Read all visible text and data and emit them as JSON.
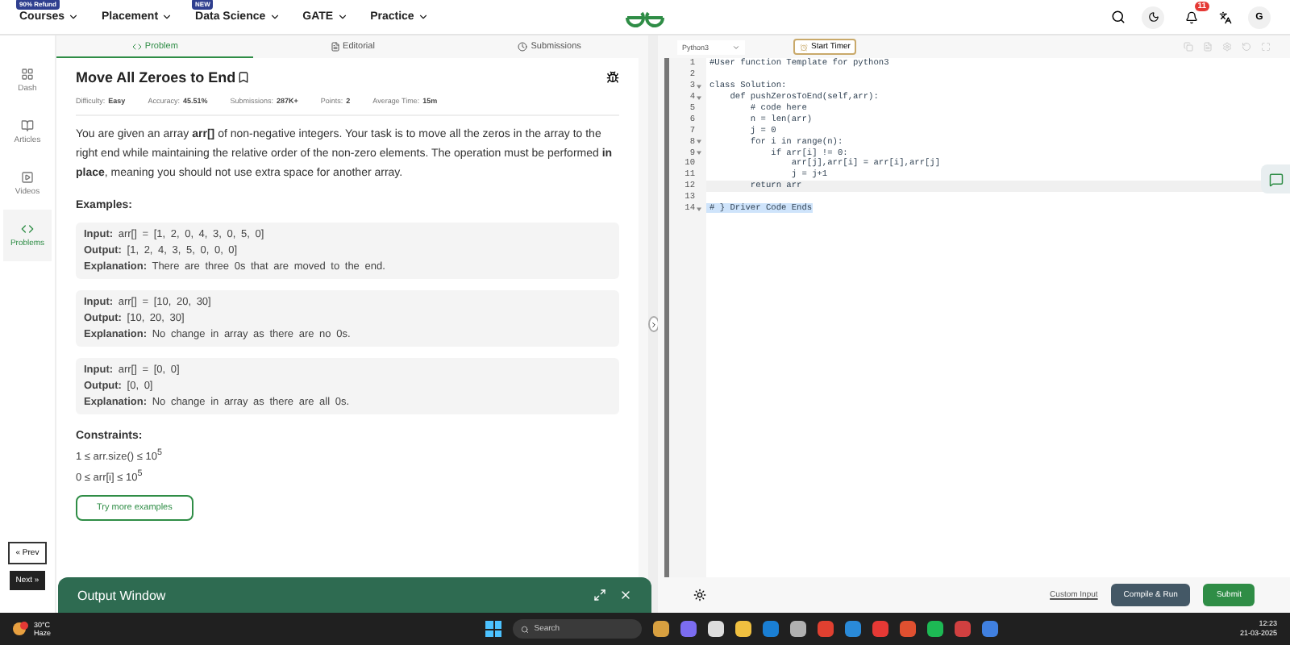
{
  "nav": {
    "items": [
      {
        "label": "Courses",
        "badge": "90% Refund"
      },
      {
        "label": "Placement"
      },
      {
        "label": "Data Science",
        "badge": "NEW"
      },
      {
        "label": "GATE"
      },
      {
        "label": "Practice"
      }
    ],
    "notification_count": "11",
    "avatar": "G"
  },
  "sidebar": {
    "items": [
      {
        "label": "Dash",
        "selected": false
      },
      {
        "label": "Articles",
        "selected": false
      },
      {
        "label": "Videos",
        "selected": false
      },
      {
        "label": "Problems",
        "selected": true
      }
    ],
    "prev": "« Prev",
    "next": "Next »"
  },
  "tabs": [
    {
      "label": "Problem",
      "selected": true
    },
    {
      "label": "Editorial",
      "selected": false
    },
    {
      "label": "Submissions",
      "selected": false
    }
  ],
  "problem": {
    "title": "Move All Zeroes to End",
    "meta": [
      {
        "label": "Difficulty:",
        "value": "Easy"
      },
      {
        "label": "Accuracy:",
        "value": "45.51%"
      },
      {
        "label": "Submissions:",
        "value": "287K+"
      },
      {
        "label": "Points:",
        "value": "2"
      },
      {
        "label": "Average Time:",
        "value": "15m"
      }
    ],
    "description": "You are given an array **arr[]** of non-negative integers. Your task is to move all the zeros in the array to the right end while maintaining the relative order of the non-zero elements. The operation must be performed **in place**, meaning you should not use extra space for another array.",
    "examples_heading": "Examples:",
    "examples": [
      {
        "input_label": "Input:",
        "input": "arr[] = [1, 2, 0, 4, 3, 0, 5, 0]",
        "output_label": "Output:",
        "output": "[1, 2, 4, 3, 5, 0, 0, 0]",
        "explanation_label": "Explanation:",
        "explanation": "There are three 0s that are moved to the end."
      },
      {
        "input_label": "Input:",
        "input": "arr[] = [10, 20, 30]",
        "output_label": "Output:",
        "output": "[10, 20, 30]",
        "explanation_label": "Explanation:",
        "explanation": "No change in array as there are no 0s."
      },
      {
        "input_label": "Input:",
        "input": "arr[] = [0, 0]",
        "output_label": "Output:",
        "output": "[0, 0]",
        "explanation_label": "Explanation:",
        "explanation": "No change in array as there are all 0s."
      }
    ],
    "constraints_heading": "Constraints:",
    "constraints": [
      "1 ≤ arr.size() ≤ 10$^{5}$",
      "0 ≤ arr[i] ≤ 10$^{5}$"
    ],
    "more_button": "Try more examples"
  },
  "output_window": {
    "title": "Output Window"
  },
  "editor": {
    "language": "Python3",
    "timer": "Start Timer",
    "lines": [
      {
        "number": "1",
        "text": "#User function Template for python3",
        "foldable": false,
        "current": false
      },
      {
        "number": "2",
        "foldable": false,
        "current": false
      },
      {
        "number": "3",
        "text": "class Solution:",
        "foldable": true,
        "current": false
      },
      {
        "number": "4",
        "text": "    def pushZerosToEnd(self,arr):",
        "foldable": true,
        "current": false
      },
      {
        "number": "5",
        "text": "        # code here",
        "foldable": false,
        "current": false
      },
      {
        "number": "6",
        "text": "        n = len(arr)",
        "foldable": false,
        "current": false
      },
      {
        "number": "7",
        "text": "        j = 0",
        "foldable": false,
        "current": false
      },
      {
        "number": "8",
        "text": "        for i in range(n):",
        "foldable": true,
        "current": false
      },
      {
        "number": "9",
        "text": "            if arr[i] != 0:",
        "foldable": true,
        "current": false
      },
      {
        "number": "10",
        "text": "                arr[j],arr[i] = arr[i],arr[j]",
        "foldable": false,
        "current": false
      },
      {
        "number": "11",
        "text": "                j = j+1",
        "foldable": false,
        "current": false
      },
      {
        "number": "12",
        "text": "        return arr",
        "foldable": false,
        "current": true
      },
      {
        "number": "13",
        "foldable": false,
        "current": false
      },
      {
        "number": "14",
        "text": "# } Driver Code Ends",
        "foldable": true,
        "current": false
      }
    ],
    "custom_input": "Custom Input",
    "compile": "Compile & Run",
    "submit": "Submit"
  },
  "taskbar": {
    "weather_temp": "30°C",
    "weather_text": "Haze",
    "search": "Search",
    "time": "12:23",
    "date": "21-03-2025"
  }
}
